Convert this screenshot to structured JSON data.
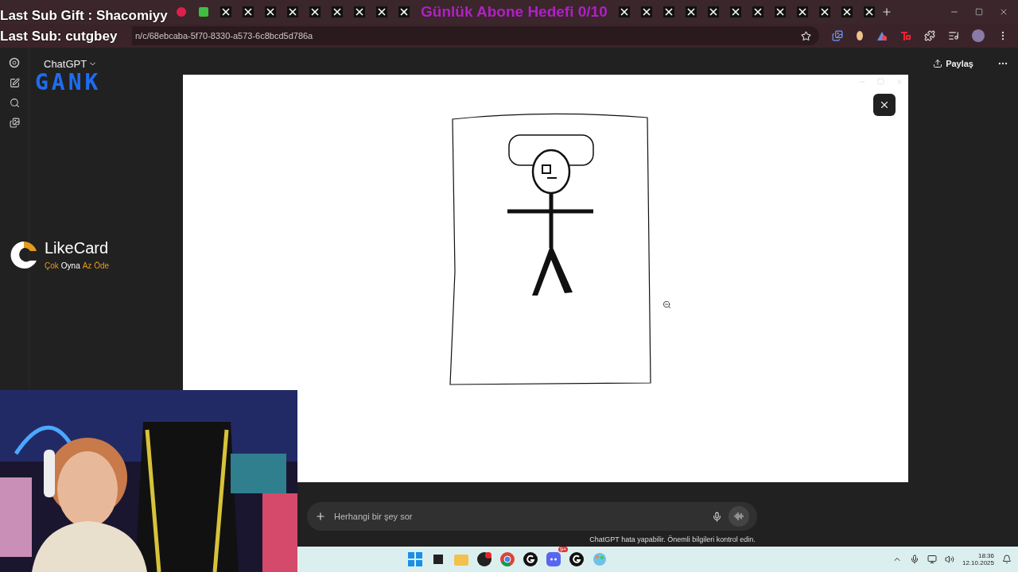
{
  "stream_overlay": {
    "last_sub_gift": "Last Sub Gift : Shacomiyy",
    "last_sub": "Last Sub: cutgbey",
    "goal": "Günlük Abone Hedefi 0/10",
    "logo": "GANK",
    "sponsor": {
      "name": "LikeCard",
      "slogan_1": "Çok",
      "slogan_2": "Oyna",
      "slogan_3": "Az Öde"
    }
  },
  "browser": {
    "tabs": [
      {
        "kind": "record"
      },
      {
        "kind": "green"
      },
      {
        "kind": "x"
      },
      {
        "kind": "x"
      },
      {
        "kind": "x"
      },
      {
        "kind": "x"
      },
      {
        "kind": "x"
      },
      {
        "kind": "x"
      },
      {
        "kind": "x"
      },
      {
        "kind": "x"
      },
      {
        "kind": "x"
      },
      {
        "kind": "x"
      },
      {
        "kind": "x"
      },
      {
        "kind": "x"
      },
      {
        "kind": "x"
      },
      {
        "kind": "x"
      },
      {
        "kind": "x"
      },
      {
        "kind": "x"
      },
      {
        "kind": "x"
      },
      {
        "kind": "x"
      },
      {
        "kind": "x"
      },
      {
        "kind": "x"
      },
      {
        "kind": "x"
      }
    ],
    "url": "n/c/68ebcaba-5f70-8330-a573-6c8bcd5d786a"
  },
  "chatgpt": {
    "model": "ChatGPT",
    "share": "Paylaş",
    "input": {
      "placeholder": "Herhangi bir şey sor"
    },
    "disclaimer": "ChatGPT hata yapabilir. Önemli bilgileri kontrol edin."
  },
  "taskbar": {
    "apps": [
      {
        "kind": "start"
      },
      {
        "kind": "taskview"
      },
      {
        "kind": "folder"
      },
      {
        "kind": "obs"
      },
      {
        "kind": "chrome"
      },
      {
        "kind": "ghub"
      },
      {
        "kind": "discord",
        "badge": "9+"
      },
      {
        "kind": "ghub"
      },
      {
        "kind": "paint"
      }
    ],
    "time": "18:36",
    "date": "12.10.2025"
  }
}
